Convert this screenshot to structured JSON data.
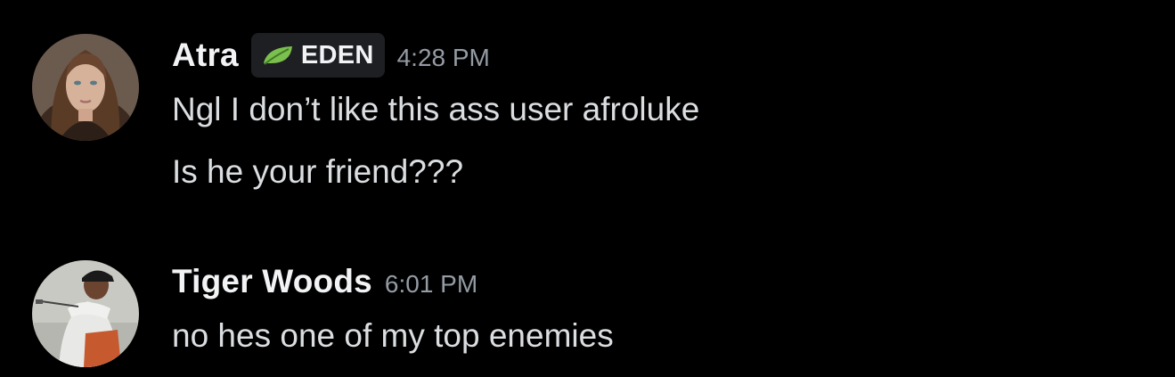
{
  "messages": [
    {
      "avatar_icon": "user-avatar-portrait",
      "username": "Atra",
      "tag": {
        "icon": "leaf-icon",
        "label": "EDEN",
        "icon_color": "#7bbf4e"
      },
      "timestamp": "4:28 PM",
      "lines": [
        "Ngl I don’t like this ass user afroluke",
        "Is he your friend???"
      ]
    },
    {
      "avatar_icon": "user-avatar-golfer",
      "username": "Tiger Woods",
      "timestamp": "6:01 PM",
      "lines": [
        "no hes one of my top enemies"
      ]
    }
  ],
  "colors": {
    "background": "#000000",
    "username": "#f2f3f5",
    "timestamp": "#949ba4",
    "message_text": "#dbdee1",
    "tag_background": "#1e1f22"
  }
}
